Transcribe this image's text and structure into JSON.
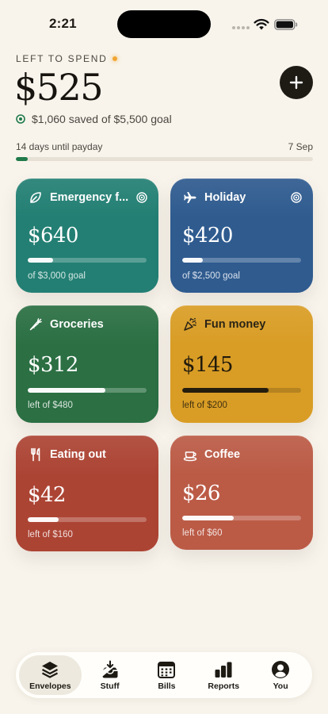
{
  "status_bar": {
    "time": "2:21"
  },
  "header": {
    "label": "LEFT TO SPEND",
    "amount": "$525",
    "saved_text": "$1,060 saved of $5,500 goal"
  },
  "payday": {
    "text": "14 days until payday",
    "date": "7 Sep",
    "progress": 0.04
  },
  "envelopes": [
    {
      "name": "Emergency fund",
      "name_display": "Emergency f...",
      "icon": "leaf-icon",
      "goal": true,
      "amount": "$640",
      "subtitle": "of $3,000 goal",
      "progress": 0.21,
      "color": "#237f73"
    },
    {
      "name": "Holiday",
      "icon": "airplane-icon",
      "goal": true,
      "amount": "$420",
      "subtitle": "of $2,500 goal",
      "progress": 0.17,
      "color": "#2f5b8f"
    },
    {
      "name": "Groceries",
      "icon": "carrot-icon",
      "goal": false,
      "amount": "$312",
      "subtitle": "left of $480",
      "progress": 0.65,
      "color": "#2b6f43"
    },
    {
      "name": "Fun money",
      "icon": "party-popper-icon",
      "goal": false,
      "amount": "$145",
      "subtitle": "left of $200",
      "progress": 0.725,
      "color": "#d99d25"
    },
    {
      "name": "Eating out",
      "icon": "fork-knife-icon",
      "goal": false,
      "amount": "$42",
      "subtitle": "left of $160",
      "progress": 0.26,
      "color": "#ac4434"
    },
    {
      "name": "Coffee",
      "icon": "coffee-cup-icon",
      "goal": false,
      "amount": "$26",
      "subtitle": "left of $60",
      "progress": 0.43,
      "color": "#bb5b46"
    }
  ],
  "tabs": [
    {
      "label": "Envelopes",
      "icon": "stack-icon",
      "active": true
    },
    {
      "label": "Stuff",
      "icon": "inbox-tray-icon",
      "active": false
    },
    {
      "label": "Bills",
      "icon": "calendar-icon",
      "active": false
    },
    {
      "label": "Reports",
      "icon": "bar-chart-icon",
      "active": false
    },
    {
      "label": "You",
      "icon": "person-icon",
      "active": false
    }
  ],
  "colors": {
    "background": "#f8f4ec",
    "accent_green": "#207a4a",
    "accent_orange": "#f0a531",
    "dark": "#1e1b15"
  }
}
